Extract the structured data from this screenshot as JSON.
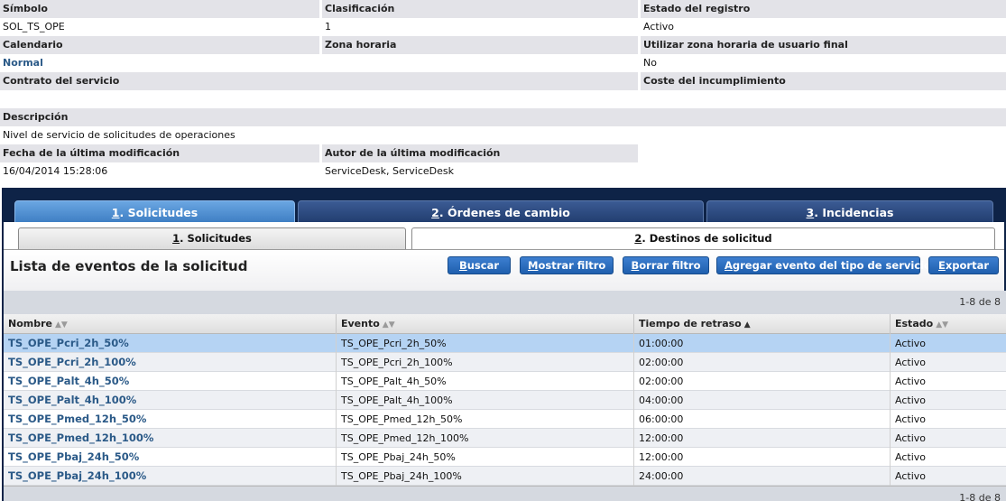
{
  "details": {
    "simbolo_label": "Símbolo",
    "simbolo_value": "SOL_TS_OPE",
    "clasificacion_label": "Clasificación",
    "clasificacion_value": "1",
    "estado_label": "Estado del registro",
    "estado_value": "Activo",
    "calendario_label": "Calendario",
    "calendario_value": "Normal",
    "zona_label": "Zona horaria",
    "zona_value": "",
    "utilizar_zona_label": "Utilizar zona horaria de usuario final",
    "utilizar_zona_value": "No",
    "contrato_label": "Contrato del servicio",
    "contrato_value": "",
    "coste_label": "Coste del incumplimiento",
    "coste_value": "",
    "descripcion_label": "Descripción",
    "descripcion_value": "Nivel de servicio de solicitudes de operaciones",
    "fecha_label": "Fecha de la última modificación",
    "fecha_value": "16/04/2014 15:28:06",
    "autor_label": "Autor de la última modificación",
    "autor_value": "ServiceDesk, ServiceDesk"
  },
  "main_tabs": [
    {
      "num": "1",
      "label": ". Solicitudes",
      "active": true
    },
    {
      "num": "2",
      "label": ". Órdenes de cambio",
      "active": false
    },
    {
      "num": "3",
      "label": ". Incidencias",
      "active": false
    }
  ],
  "sub_tabs": [
    {
      "num": "1",
      "label": ". Solicitudes",
      "active": true
    },
    {
      "num": "2",
      "label": ". Destinos de solicitud",
      "active": false
    }
  ],
  "list": {
    "title": "Lista de eventos de la solicitud",
    "buttons": {
      "buscar_u": "B",
      "buscar_rest": "uscar",
      "mostrar_u": "M",
      "mostrar_rest": "ostrar filtro",
      "borrar_u": "B",
      "borrar_rest": "orrar filtro",
      "agregar_u": "A",
      "agregar_rest": "gregar evento del tipo de servicio",
      "exportar_u": "E",
      "exportar_rest": "xportar"
    },
    "pager_top": "1-8 de 8",
    "pager_bottom": "1-8 de 8",
    "columns": [
      "Nombre",
      "Evento",
      "Tiempo de retraso",
      "Estado"
    ],
    "rows": [
      {
        "nombre": "TS_OPE_Pcri_2h_50%",
        "evento": "TS_OPE_Pcri_2h_50%",
        "tiempo": "01:00:00",
        "estado": "Activo"
      },
      {
        "nombre": "TS_OPE_Pcri_2h_100%",
        "evento": "TS_OPE_Pcri_2h_100%",
        "tiempo": "02:00:00",
        "estado": "Activo"
      },
      {
        "nombre": "TS_OPE_Palt_4h_50%",
        "evento": "TS_OPE_Palt_4h_50%",
        "tiempo": "02:00:00",
        "estado": "Activo"
      },
      {
        "nombre": "TS_OPE_Palt_4h_100%",
        "evento": "TS_OPE_Palt_4h_100%",
        "tiempo": "04:00:00",
        "estado": "Activo"
      },
      {
        "nombre": "TS_OPE_Pmed_12h_50%",
        "evento": "TS_OPE_Pmed_12h_50%",
        "tiempo": "06:00:00",
        "estado": "Activo"
      },
      {
        "nombre": "TS_OPE_Pmed_12h_100%",
        "evento": "TS_OPE_Pmed_12h_100%",
        "tiempo": "12:00:00",
        "estado": "Activo"
      },
      {
        "nombre": "TS_OPE_Pbaj_24h_50%",
        "evento": "TS_OPE_Pbaj_24h_50%",
        "tiempo": "12:00:00",
        "estado": "Activo"
      },
      {
        "nombre": "TS_OPE_Pbaj_24h_100%",
        "evento": "TS_OPE_Pbaj_24h_100%",
        "tiempo": "24:00:00",
        "estado": "Activo"
      }
    ]
  },
  "colors": {
    "label_bg": "#e3e3e8",
    "link": "#2b5a88",
    "panel_bg": "#0e2347",
    "active_tab": "#4f8fd2",
    "button": "#2b6cbf",
    "selected_row": "#b5d3f3"
  },
  "icons": {
    "sort": "sort-both-icon",
    "sort_asc": "sort-ascending-icon"
  }
}
